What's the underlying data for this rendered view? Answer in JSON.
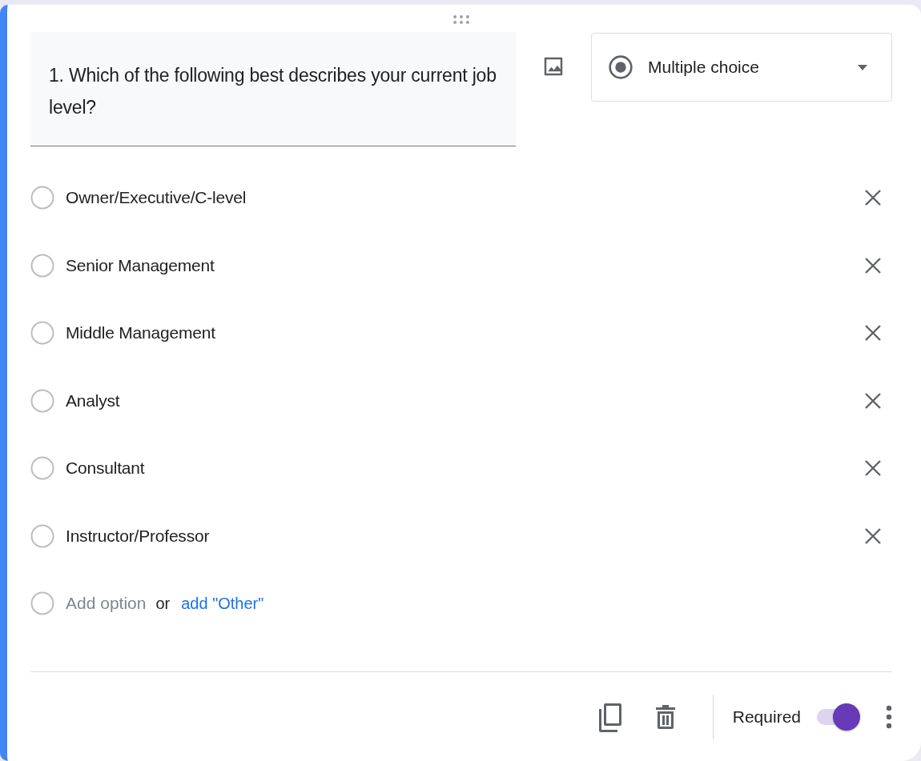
{
  "question": {
    "title": "1. Which of the following best describes your current job level?"
  },
  "question_type": {
    "label": "Multiple choice"
  },
  "options": [
    {
      "label": "Owner/Executive/C-level",
      "selected": false
    },
    {
      "label": "Senior Management",
      "selected": false
    },
    {
      "label": "Middle Management",
      "selected": false
    },
    {
      "label": "Analyst",
      "selected": false
    },
    {
      "label": "Consultant",
      "selected": false
    },
    {
      "label": "Instructor/Professor",
      "selected": false
    }
  ],
  "add_option": {
    "selected": false,
    "placeholder": "Add option",
    "separator": "or",
    "link": "add \"Other\""
  },
  "footer": {
    "required_label": "Required",
    "required_on": true
  }
}
